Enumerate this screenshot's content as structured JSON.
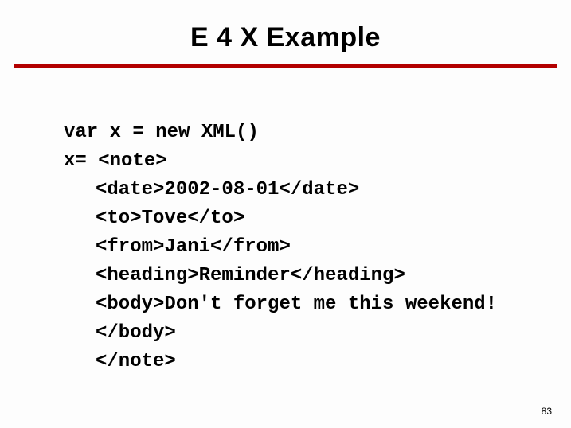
{
  "title": "E 4 X Example",
  "code": {
    "line1": "var x = new XML()",
    "line2": "x= <note>",
    "line3": "<date>2002-08-01</date>",
    "line4": "<to>Tove</to>",
    "line5": "<from>Jani</from>",
    "line6": "<heading>Reminder</heading>",
    "line7": "<body>Don't forget me this weekend!</body>",
    "line8": "</note>"
  },
  "pageNumber": "83"
}
